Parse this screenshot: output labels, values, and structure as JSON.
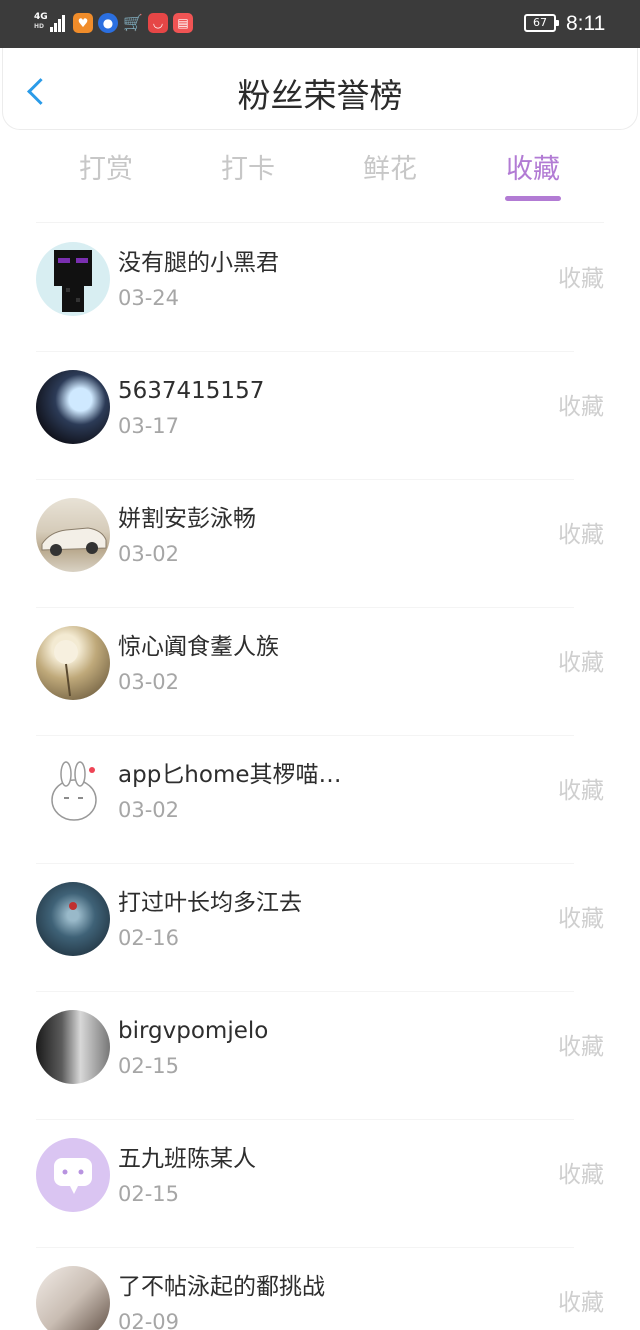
{
  "status_bar": {
    "network": "4G",
    "network_sub": "HD",
    "battery": "67",
    "time": "8:11",
    "app_icons": [
      "health-app-icon",
      "browser-app-icon",
      "shopping-cart-icon",
      "store-app-icon",
      "reader-app-icon"
    ]
  },
  "header": {
    "title": "粉丝荣誉榜",
    "back_icon": "chevron-left-icon"
  },
  "tabs": [
    {
      "label": "打赏",
      "active": false
    },
    {
      "label": "打卡",
      "active": false
    },
    {
      "label": "鲜花",
      "active": false
    },
    {
      "label": "收藏",
      "active": true
    }
  ],
  "list": [
    {
      "name": "没有腿的小黑君",
      "date": "03-24",
      "action": "收藏"
    },
    {
      "name": "5637415157",
      "date": "03-17",
      "action": "收藏"
    },
    {
      "name": "姘割安彭泳畅",
      "date": "03-02",
      "action": "收藏"
    },
    {
      "name": "惊心阗食耋人族",
      "date": "03-02",
      "action": "收藏"
    },
    {
      "name": "app匕home其椤喵…",
      "date": "03-02",
      "action": "收藏"
    },
    {
      "name": "打过叶长均多江去",
      "date": "02-16",
      "action": "收藏"
    },
    {
      "name": "birgvpomjelo",
      "date": "02-15",
      "action": "收藏"
    },
    {
      "name": "五九班陈某人",
      "date": "02-15",
      "action": "收藏"
    },
    {
      "name": "了不帖泳起的鄱挑战",
      "date": "02-09",
      "action": "收藏"
    }
  ],
  "colors": {
    "accent": "#b27bd4",
    "back_arrow": "#2a9be8",
    "inactive_tab": "#c7c7c7",
    "status_bar_bg": "#3b3b3b"
  }
}
